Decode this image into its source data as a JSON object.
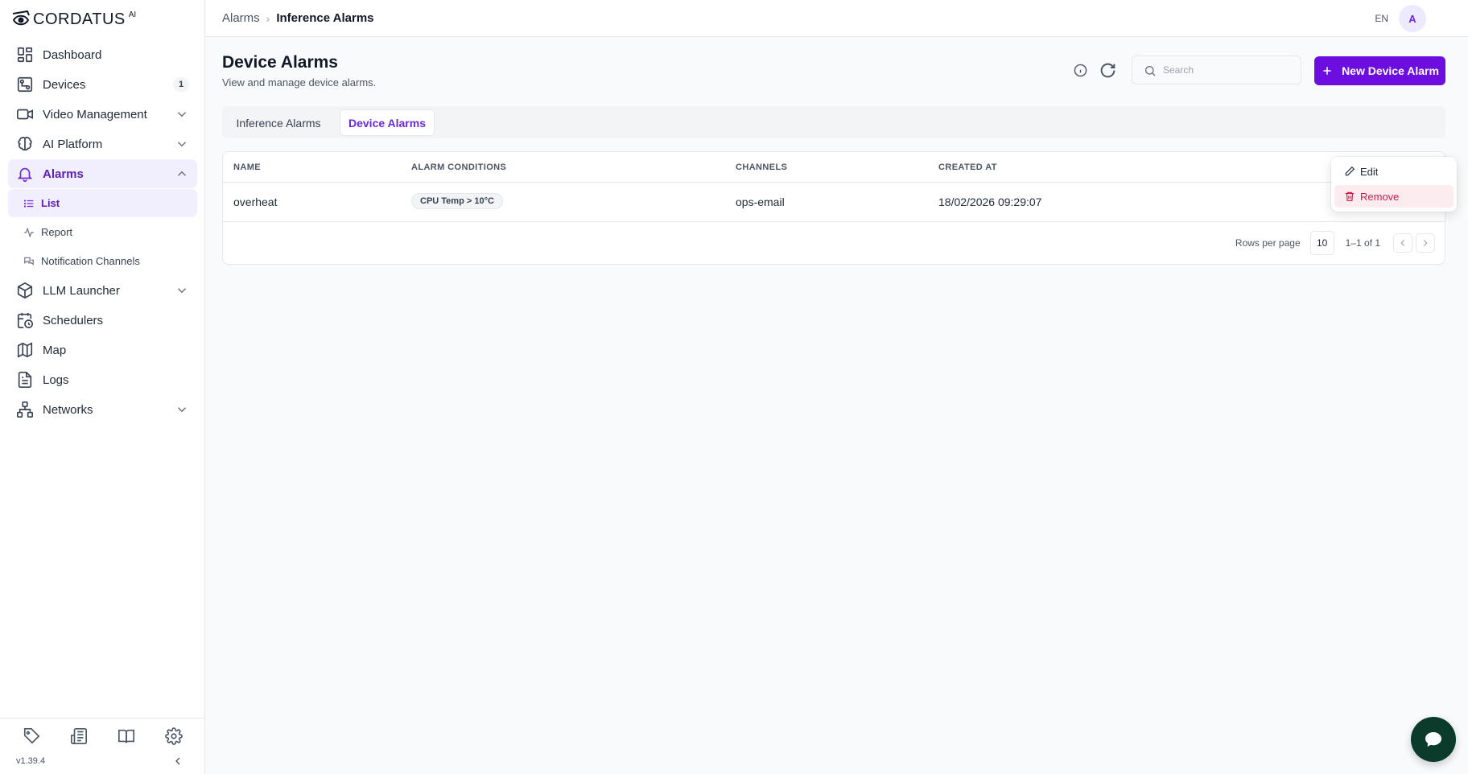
{
  "brand": {
    "name": "CORDATUS",
    "suffix": "AI"
  },
  "sidebar": {
    "items": [
      {
        "label": "Dashboard",
        "icon": "dashboard-icon"
      },
      {
        "label": "Devices",
        "icon": "devices-icon",
        "badge": "1"
      },
      {
        "label": "Video Management",
        "icon": "video-icon",
        "expandable": true
      },
      {
        "label": "AI Platform",
        "icon": "brain-icon",
        "expandable": true
      },
      {
        "label": "Alarms",
        "icon": "bell-icon",
        "expanded": true,
        "active": true,
        "children": [
          {
            "label": "List",
            "icon": "list-icon",
            "active": true
          },
          {
            "label": "Report",
            "icon": "activity-icon"
          },
          {
            "label": "Notification Channels",
            "icon": "chat-icon"
          }
        ]
      },
      {
        "label": "LLM Launcher",
        "icon": "package-icon",
        "expandable": true
      },
      {
        "label": "Schedulers",
        "icon": "calendar-clock-icon"
      },
      {
        "label": "Map",
        "icon": "map-icon"
      },
      {
        "label": "Logs",
        "icon": "file-text-icon"
      },
      {
        "label": "Networks",
        "icon": "network-icon",
        "expandable": true
      }
    ],
    "bottom_icons": [
      "tag-icon",
      "newspaper-icon",
      "book-icon",
      "gear-icon"
    ],
    "version": "v1.39.4"
  },
  "header": {
    "breadcrumb": [
      {
        "label": "Alarms"
      },
      {
        "label": "Inference Alarms"
      }
    ],
    "language": "EN",
    "avatar_initial": "A"
  },
  "main": {
    "title": "Device Alarms",
    "subtitle": "View and manage device alarms.",
    "search_placeholder": "Search",
    "new_button_label": "New Device Alarm",
    "tabs": [
      {
        "label": "Inference Alarms",
        "active": false
      },
      {
        "label": "Device Alarms",
        "active": true
      }
    ],
    "table": {
      "columns": [
        "NAME",
        "ALARM CONDITIONS",
        "CHANNELS",
        "CREATED AT"
      ],
      "rows": [
        {
          "name": "overheat",
          "condition": "CPU Temp > 10°C",
          "channels": "ops-email",
          "created_at": "18/02/2026 09:29:07"
        }
      ],
      "pagination": {
        "rows_per_page_label": "Rows per page",
        "rows_per_page": "10",
        "range": "1–1 of 1"
      }
    },
    "row_menu": {
      "edit_label": "Edit",
      "remove_label": "Remove"
    }
  },
  "colors": {
    "accent": "#6d0ee0",
    "active_bg": "#f1eefe",
    "danger": "#c81e4e",
    "chat_fab": "#0b3b2a"
  }
}
